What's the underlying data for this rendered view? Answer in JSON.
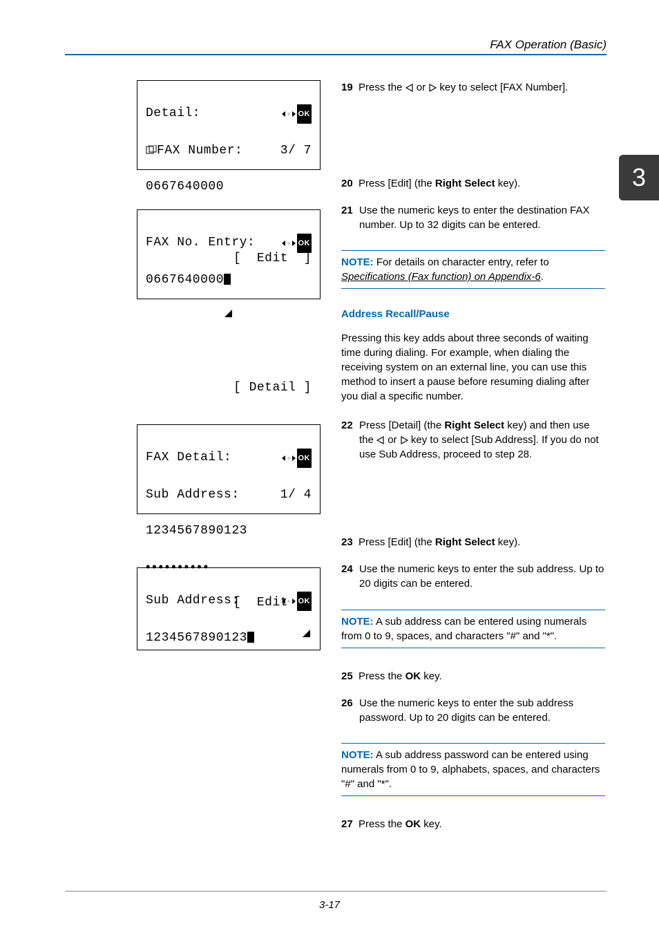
{
  "header": {
    "section_title": "FAX Operation (Basic)"
  },
  "chapter_tab": "3",
  "lcd1": {
    "line1_a": "Detail:",
    "nav_ok": "OK",
    "line2_a": "FAX Number:",
    "line2_b": "3/ 7",
    "line3": "0667640000",
    "softkey": "[  Edit  ]"
  },
  "lcd2": {
    "line1_a": "FAX No. Entry:",
    "nav_ok": "OK",
    "line2": "0667640000",
    "softkey": "[ Detail ]"
  },
  "lcd3": {
    "line1_a": "FAX Detail:",
    "nav_ok": "OK",
    "line2_a": "Sub Address:",
    "line2_b": "1/ 4",
    "line3": "1234567890123",
    "dots": "••••••••••",
    "softkey": "[  Edit  ]"
  },
  "lcd4": {
    "line1_a": "Sub Address:",
    "nav_ok": "OK",
    "line2": "1234567890123"
  },
  "steps": {
    "s19": {
      "num": "19",
      "a": "Press the ",
      "b": " or ",
      "c": " key to select [FAX Number]."
    },
    "s20": {
      "num": "20",
      "a": "Press [Edit] (the ",
      "bold": "Right Select",
      "b": " key)."
    },
    "s21": {
      "num": "21",
      "text": "Use the numeric keys to enter the destination FAX number. Up to 32 digits can be entered."
    },
    "note1": {
      "label": "NOTE:",
      "a": " For details on character entry, refer to ",
      "link": "Specifications (Fax function) on Appendix-6",
      "b": "."
    },
    "addr_head": "Address Recall/Pause",
    "addr_body": "Pressing this key adds about three seconds of waiting time during dialing. For example, when dialing the receiving system on an external line, you can use this method to insert a pause before resuming dialing after you dial a specific number.",
    "s22": {
      "num": "22",
      "a": "Press [Detail] (the ",
      "bold": "Right Select",
      "b": " key) and then use the ",
      "c": " or ",
      "d": " key to select [Sub Address]. If you do not use Sub Address, proceed to step 28."
    },
    "s23": {
      "num": "23",
      "a": "Press [Edit] (the ",
      "bold": "Right Select",
      "b": " key)."
    },
    "s24": {
      "num": "24",
      "text": "Use the numeric keys to enter the sub address. Up to 20 digits can be entered."
    },
    "note2": {
      "label": "NOTE:",
      "text": " A sub address can be entered using numerals from 0 to 9, spaces, and characters \"#\" and \"*\"."
    },
    "s25": {
      "num": "25",
      "a": "Press the ",
      "bold": "OK",
      "b": " key."
    },
    "s26": {
      "num": "26",
      "text": "Use the numeric keys to enter the sub address password. Up to 20 digits can be entered."
    },
    "note3": {
      "label": "NOTE:",
      "text": " A sub address password can be entered using numerals from 0 to 9, alphabets, spaces, and characters \"#\" and \"*\"."
    },
    "s27": {
      "num": "27",
      "a": "Press the ",
      "bold": "OK",
      "b": " key."
    }
  },
  "footer": {
    "page": "3-17"
  }
}
